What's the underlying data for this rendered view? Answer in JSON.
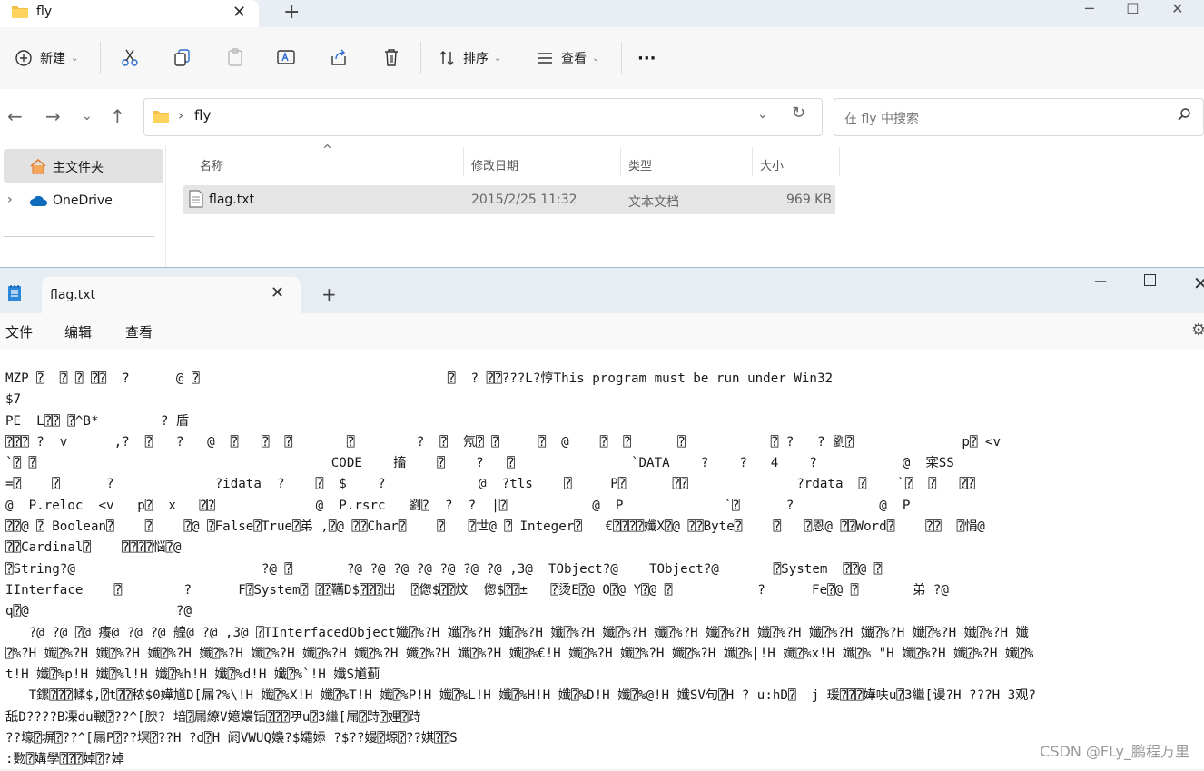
{
  "explorer": {
    "tab_title": "fly",
    "toolbar": {
      "new_label": "新建",
      "sort_label": "排序",
      "view_label": "查看",
      "more_label": "···"
    },
    "address": {
      "path": "fly",
      "search_placeholder": "在 fly 中搜索"
    },
    "nav": {
      "home_label": "主文件夹",
      "onedrive_label": "OneDrive"
    },
    "columns": {
      "name": "名称",
      "modified": "修改日期",
      "type": "类型",
      "size": "大小"
    },
    "files": [
      {
        "name": "flag.txt",
        "modified": "2015/2/25 11:32",
        "type": "文本文档",
        "size": "969 KB"
      }
    ]
  },
  "notepad": {
    "tab_title": "flag.txt",
    "menu": [
      "文件",
      "编辑",
      "查看"
    ],
    "content_lines": [
      "MZP ⍰  ⍰ ⍰ ⍰⍰  ?      @ ⍰                                ⍰  ? ⍰⍰???L?悙This program must be run under Win32",
      "$7",
      "PE  L⍰⍰ ⍰^B*        ? 盾",
      "⍰⍰⍰ ?  v      ,?  ⍰   ?   @  ⍰   ⍰  ⍰       ⍰        ?  ⍰  氖⍰ ⍰     ⍰  @    ⍰  ⍰      ⍰           ⍰ ?   ? 劉⍰              p⍰ <v",
      "`⍰ ⍰                                      CODE    搐    ⍰    ?   ⍰               `DATA    ?    ?   4    ?           @  寀SS",
      "=⍰    ⍰      ?             ?idata  ?    ⍰  $    ?            @  ?tls    ⍰     P⍰      ⍰⍰              ?rdata  ⍰    `⍰  ⍰   ⍰⍰",
      "@  P.reloc  <v   p⍰  x   ⍰⍰             @  P.rsrc   劉⍰  ?  ?  |⍰           @  P             `⍰      ?           @  P",
      "⍰⍰@ ⍰ Boolean⍰    ⍰    ⍰@ ⍰False⍰True⍰弟 ,⍰@ ⍰⍰Char⍰    ⍰   ⍰世@ ⍰ Integer⍰   €⍰⍰⍰⍰孅X⍰@ ⍰⍰Byte⍰    ⍰   ⍰恩@ ⍰⍰Word⍰    ⍰⍰  ⍰悁@",
      "⍰⍰Cardinal⍰    ⍰⍰⍰⍰悩⍰@",
      "⍰String?@                        ?@ ⍰       ?@ ?@ ?@ ?@ ?@ ?@ ?@ ,3@  TObject?@    TObject?@       ⍰System  ⍰⍰@ ⍰",
      "IInterface    ⍰        ?      F⍰System⍰ ⍰⍰韉D$⍰⍰⍰岀  ⍰偬$⍰⍰炆  偬$⍰⍰±   ⍰烫E⍰@ O⍰@ Y⍰@ ⍰           ?      Fe⍰@ ⍰       弟 ?@",
      "q⍰@                   ?@",
      "   ?@ ?@ ⍰@ 癢@ ?@ ?@ 艎@ ?@ ,3@ ⍰TInterfacedObject孅⍰%?H 孅⍰%?H 孅⍰%?H 孅⍰%?H 孅⍰%?H 孅⍰%?H 孅⍰%?H 孅⍰%?H 孅⍰%?H 孅⍰%?H 孅⍰%?H 孅⍰%?H 孅",
      "⍰%?H 孅⍰%?H 孅⍰%?H 孅⍰%?H 孅⍰%?H 孅⍰%?H 孅⍰%?H 孅⍰%?H 孅⍰%?H 孅⍰%?H 孅⍰%€!H 孅⍰%?H 孅⍰%?H 孅⍰%?H 孅⍰%|!H 孅⍰%x!H 孅⍰% \"H 孅⍰%?H 孅⍰%?H 孅⍰%",
      "t!H 孅⍰%p!H 孅⍰%l!H 孅⍰%h!H 孅⍰%d!H 孅⍰%`!H 孅S馗蓟",
      "   T鏍⍰⍰⍰輮$,⍰t⍰⍰秾$0嬅馗D[屚?%\\!H 孅⍰%X!H 孅⍰%T!H 孅⍰%P!H 孅⍰%L!H 孅⍰%H!H 孅⍰%D!H 孅⍰%@!H 孅SV句⍰H ? u:hD⍰  j 瑗⍰⍰⍰嬅呋u⍰3繼[谩?H ???H 3观?",
      "舐D????B凓du皸⍰??^[腴? 堷⍰屚繚V嬑嬝铦⍰⍰⍰吚u⍰3繼[屚⍰跱⍰娌⍰跱",
      "??壕⍰塀⍰??^[屚P⍰??塓⍰??H ?d⍰H 阏VWUQ嬝?$孀婖 ?$??嫚⍰塬⍰??娸⍰⍰S",
      ":覅⍰媾學⍰⍰⍰婥⍰?婥"
    ]
  },
  "watermark": "CSDN @FLy_鹏程万里"
}
